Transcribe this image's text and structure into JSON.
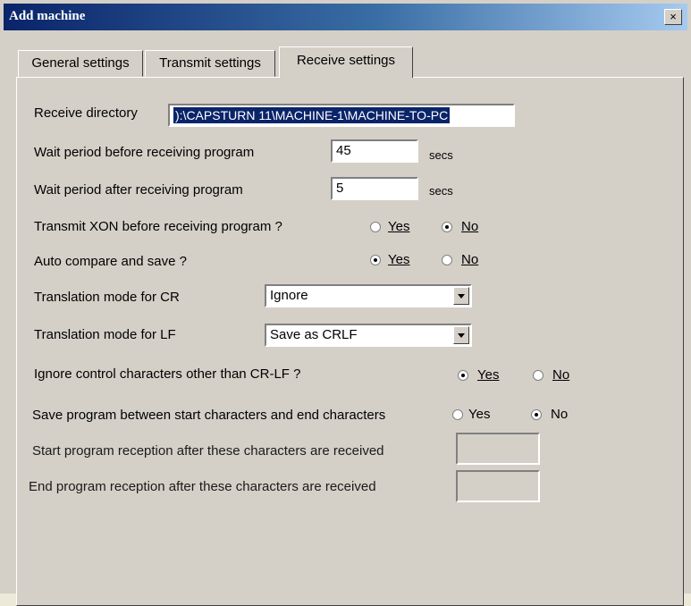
{
  "window": {
    "title": "Add machine",
    "close_glyph": "×"
  },
  "tabs": [
    {
      "label": "General settings",
      "active": false
    },
    {
      "label": "Transmit settings",
      "active": false
    },
    {
      "label": "Receive settings",
      "active": true
    }
  ],
  "receive": {
    "directory_label": "Receive directory",
    "directory_value": "):\\CAPSTURN 11\\MACHINE-1\\MACHINE-TO-PC",
    "wait_before_label": "Wait period before receiving program",
    "wait_before_value": "45",
    "wait_after_label": "Wait period after receiving program",
    "wait_after_value": "5",
    "secs_unit": "secs",
    "xon_label": "Transmit  XON before receiving program ?",
    "xon_selected": "No",
    "auto_compare_label": "Auto compare and save ?",
    "auto_compare_selected": "Yes",
    "cr_label": "Translation mode for CR",
    "cr_value": "Ignore",
    "lf_label": "Translation mode for LF",
    "lf_value": "Save as CRLF",
    "ignore_ctrl_label": "Ignore control characters other than CR-LF  ?",
    "ignore_ctrl_selected": "Yes",
    "save_between_label": "Save program between start characters and end characters",
    "save_between_selected": "No",
    "start_chars_label": "Start program reception after these characters are received",
    "start_chars_value": "",
    "end_chars_label": "End program reception after these characters are received",
    "end_chars_value": ""
  },
  "options": {
    "yes": "Yes",
    "no": "No"
  }
}
